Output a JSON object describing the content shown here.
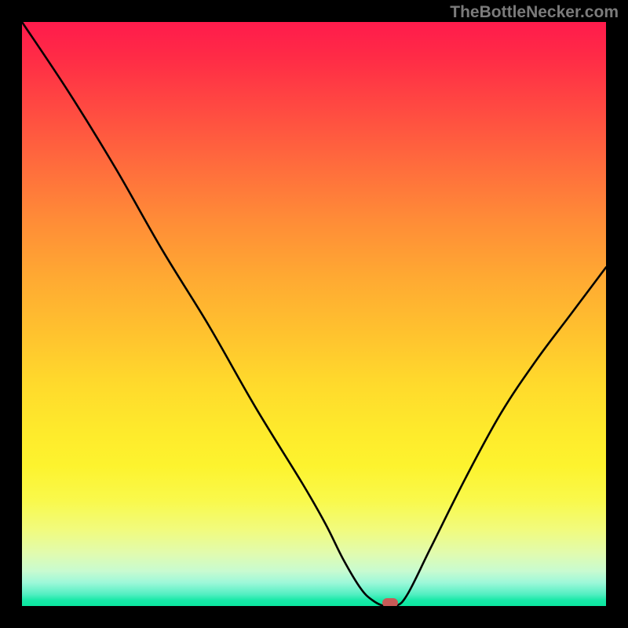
{
  "watermark": "TheBottleNecker.com",
  "colors": {
    "frame": "#000000",
    "curve": "#000000",
    "marker": "#c85a57"
  },
  "chart_data": {
    "type": "line",
    "title": "",
    "xlabel": "",
    "ylabel": "",
    "xlim": [
      0,
      100
    ],
    "ylim": [
      0,
      100
    ],
    "grid": false,
    "series": [
      {
        "name": "bottleneck-curve",
        "x": [
          0,
          8,
          16,
          24,
          32,
          40,
          48,
          52,
          55,
          58,
          60,
          62,
          64,
          66,
          70,
          76,
          82,
          88,
          94,
          100
        ],
        "values": [
          100,
          88,
          75,
          61,
          48,
          34,
          21,
          14,
          8,
          3,
          1,
          0,
          0,
          2,
          10,
          22,
          33,
          42,
          50,
          58
        ]
      }
    ],
    "marker": {
      "x": 63,
      "y": 0
    },
    "legend": false
  }
}
